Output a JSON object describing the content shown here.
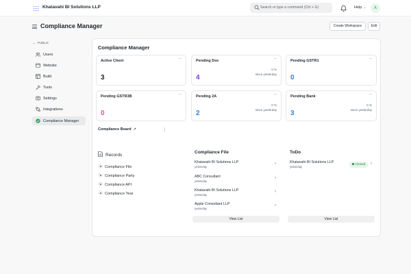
{
  "navbar": {
    "brand": "Khatavahi BI Solutions LLP",
    "search_placeholder": "Search or type a command (Ctrl + G)",
    "help_label": "Help",
    "avatar_initial": "A"
  },
  "header": {
    "title": "Compliance Manager",
    "create_workspace_label": "Create Workspace",
    "edit_label": "Edit"
  },
  "sidebar": {
    "heading": "PUBLIC",
    "items": [
      {
        "label": "Users",
        "icon": "users-icon"
      },
      {
        "label": "Website",
        "icon": "website-icon"
      },
      {
        "label": "Build",
        "icon": "build-icon"
      },
      {
        "label": "Tools",
        "icon": "tools-icon"
      },
      {
        "label": "Settings",
        "icon": "settings-icon"
      },
      {
        "label": "Integrations",
        "icon": "integrations-icon"
      },
      {
        "label": "Compliance Manager",
        "icon": "compliance-check-icon",
        "active": true
      }
    ]
  },
  "workspace": {
    "title": "Compliance Manager",
    "number_cards": [
      {
        "label": "Active Client",
        "value": "3",
        "pct": "",
        "since": "",
        "color": "#1f272e"
      },
      {
        "label": "Pending Doc",
        "value": "4",
        "pct": "0 %",
        "since": "since yesterday",
        "color": "#7c3ad6"
      },
      {
        "label": "Pending GSTR1",
        "value": "0",
        "pct": "",
        "since": "",
        "color": "#2d7ff0"
      },
      {
        "label": "Pending GSTR3B",
        "value": "0",
        "pct": "",
        "since": "",
        "color": "#e94f8a"
      },
      {
        "label": "Pending 2A",
        "value": "2",
        "pct": "0 %",
        "since": "since yesterday",
        "color": "#2d7ff0"
      },
      {
        "label": "Pending Bank",
        "value": "3",
        "pct": "0 %",
        "since": "since yesterday",
        "color": "#2d7ff0"
      }
    ],
    "board_link": "Compliance Board",
    "records": {
      "title": "Records",
      "items": [
        "Compliance File",
        "Compliance Party",
        "Compliance API",
        "Compliance Year"
      ]
    },
    "compliance_file": {
      "title": "Compliance File",
      "items": [
        {
          "name": "Khatavahi BI Solutions LLP",
          "sub": "yesterday"
        },
        {
          "name": "ABC Consultant",
          "sub": "yesterday"
        },
        {
          "name": "Khatavahi BI Solutions LLP",
          "sub": "yesterday"
        },
        {
          "name": "Apple Consultant LLP",
          "sub": "yesterday"
        }
      ],
      "view_list": "View List"
    },
    "todo": {
      "title": "ToDo",
      "items": [
        {
          "name": "Khatavahi BI Solutions LLP",
          "sub": "yesterday",
          "status": "Closed"
        }
      ],
      "view_list": "View List"
    }
  },
  "colors": {
    "accent": "#2d66f5",
    "success": "#2f8a4a"
  }
}
